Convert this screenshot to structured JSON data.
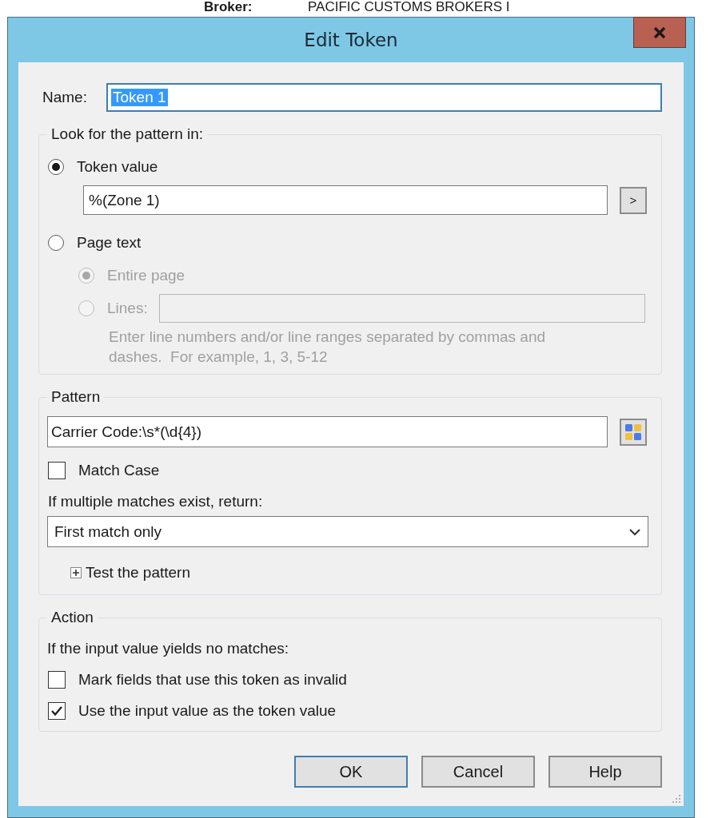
{
  "background": {
    "label": "Broker:",
    "value": "PACIFIC CUSTOMS BROKERS I"
  },
  "window": {
    "title": "Edit Token"
  },
  "name": {
    "label": "Name:",
    "value": "Token 1",
    "text_selected": true
  },
  "source_group": {
    "legend": "Look for the pattern in:",
    "options": [
      {
        "label": "Token value",
        "selected": true
      },
      {
        "label": "Page text",
        "selected": false
      }
    ],
    "token_field": {
      "value": "%(Zone 1)"
    },
    "insert_button": ">",
    "page_options": [
      {
        "label": "Entire page",
        "selected": true,
        "disabled": true
      },
      {
        "label": "Lines:",
        "selected": false,
        "disabled": true
      }
    ],
    "lines_field": {
      "disabled": true
    },
    "hint": {
      "text": "Enter line numbers and/or line ranges separated by commas and\ndashes.  For example, 1, 3, 5-12",
      "disabled": true
    }
  },
  "pattern_group": {
    "legend": "Pattern",
    "field": {
      "value": "Carrier Code:\\s*(\\d{4})"
    },
    "match_case": {
      "label": "Match Case",
      "checked": false
    },
    "multi_label": "If multiple matches exist, return:",
    "dropdown": {
      "value": "First match only"
    },
    "test": {
      "label": "Test the pattern",
      "expanded": false
    }
  },
  "action_group": {
    "legend": "Action",
    "prompt": "If the input value yields no matches:",
    "options": [
      {
        "label": "Mark fields that use this token as invalid",
        "checked": false
      },
      {
        "label": "Use the input value as the token value",
        "checked": true
      }
    ]
  },
  "buttons": [
    {
      "label": "OK",
      "default": true
    },
    {
      "label": "Cancel",
      "default": false
    },
    {
      "label": "Help",
      "default": false
    }
  ]
}
